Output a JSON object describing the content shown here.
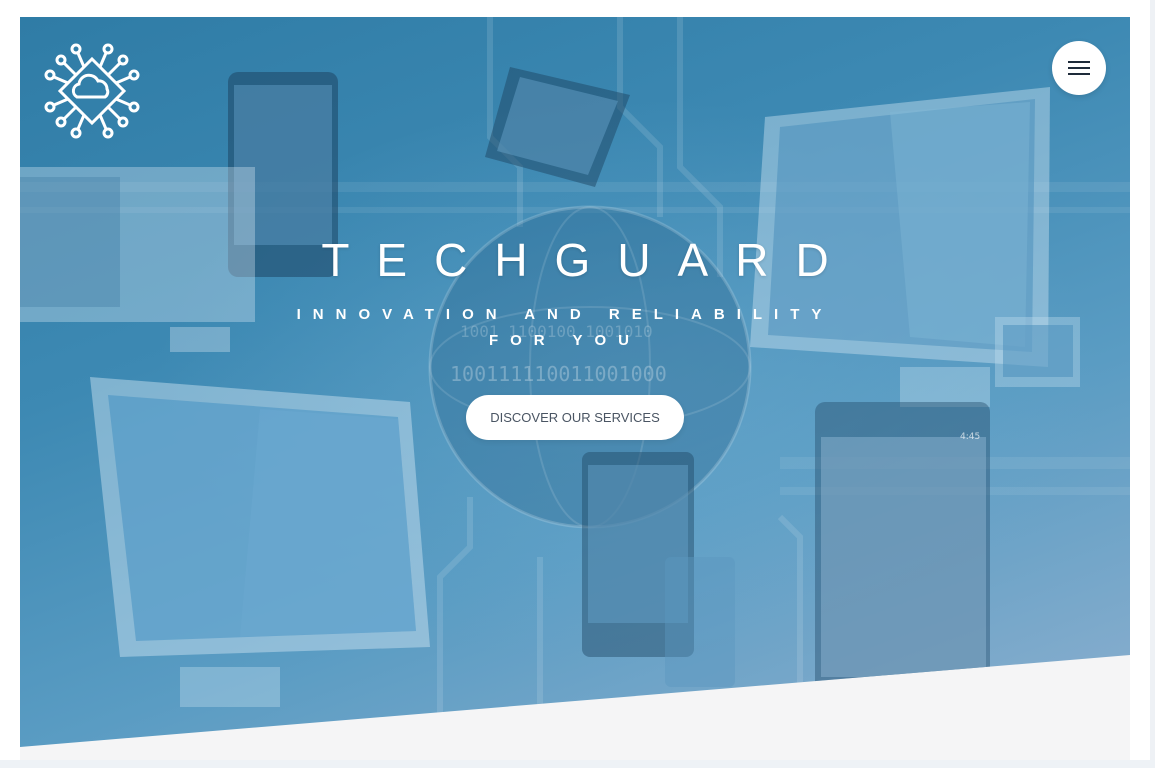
{
  "brand": {
    "logo_icon": "circuit-cloud-icon",
    "title": "TECHGUARD",
    "tagline": "INNOVATION AND RELIABILITY FOR YOU"
  },
  "header": {
    "menu_icon": "hamburger-menu-icon"
  },
  "hero": {
    "cta_label": "DISCOVER OUR SERVICES",
    "background_colors": [
      "#2f7ca6",
      "#5a9cc3",
      "#8eb0cf"
    ],
    "device_screen_text": [
      "4:45",
      "100111110011001000"
    ]
  },
  "colors": {
    "accent": "#3d89b3",
    "button_bg": "#ffffff",
    "button_text": "#4a5563",
    "page_bg": "#f5f5f6"
  }
}
